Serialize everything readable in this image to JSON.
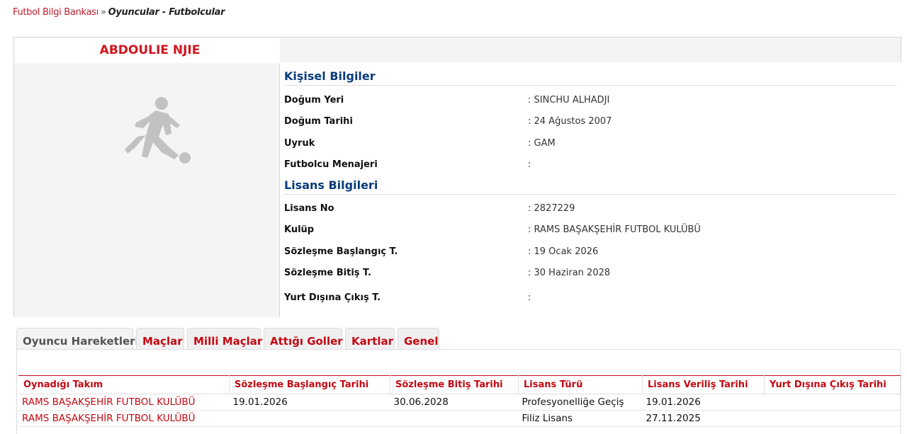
{
  "breadcrumb": {
    "home": "Futbol Bilgi Bankası",
    "separator": "»",
    "current": "Oyuncular - Futbolcular"
  },
  "player": {
    "name": "ABDOULIE NJIE"
  },
  "personal": {
    "title": "Kişisel Bilgiler",
    "rows": [
      {
        "label": "Doğum Yeri",
        "value": ":  SINCHU ALHADJI"
      },
      {
        "label": "Doğum Tarihi",
        "value": ":  24 Ağustos 2007"
      },
      {
        "label": "Uyruk",
        "value": ":  GAM"
      },
      {
        "label": "Futbolcu Menajeri",
        "value": ":"
      }
    ]
  },
  "license": {
    "title": "Lisans Bilgileri",
    "rows": [
      {
        "label": "Lisans No",
        "value": ": 2827229"
      },
      {
        "label": "Kulüp",
        "value": ": RAMS BAŞAKŞEHİR FUTBOL KULÜBÜ"
      },
      {
        "label": "Sözleşme Başlangıç T.",
        "value": ": 19 Ocak 2026"
      },
      {
        "label": "Sözleşme Bitiş T.",
        "value": ": 30 Haziran 2028"
      },
      {
        "label": "Yurt Dışına Çıkış T.",
        "value": ":"
      }
    ]
  },
  "tabs": [
    "Oyuncu Hareketleri",
    "Maçlar",
    "Milli Maçlar",
    "Attığı Goller",
    "Kartlar",
    "Genel"
  ],
  "movements": {
    "headers": [
      "Oynadığı Takım",
      "Sözleşme Başlangıç Tarihi",
      "Sözleşme Bitiş Tarihi",
      "Lisans Türü",
      "Lisans Veriliş Tarihi",
      "Yurt Dışına Çıkış Tarihi"
    ],
    "rows": [
      [
        "RAMS BAŞAKŞEHİR FUTBOL KULÜBÜ",
        "19.01.2026",
        "30.06.2028",
        "Profesyonelliğe Geçiş",
        "19.01.2026",
        ""
      ],
      [
        "RAMS BAŞAKŞEHİR FUTBOL KULÜBÜ",
        "",
        "",
        "Filiz Lisans",
        "27.11.2025",
        ""
      ]
    ]
  },
  "colors": {
    "accent": "#c40812",
    "section_title": "#0a3c7a",
    "name": "#d4141e"
  }
}
